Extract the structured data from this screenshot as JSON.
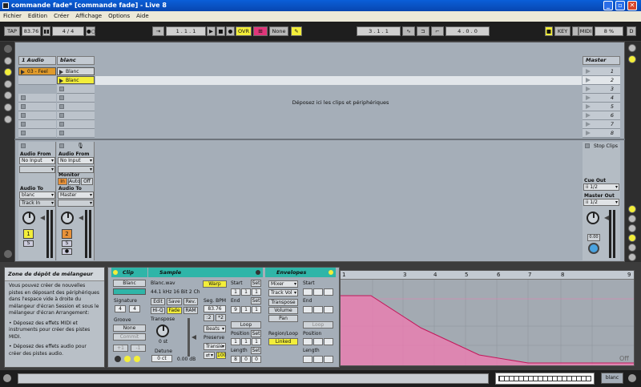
{
  "window": {
    "title": "commande fade*  [commande fade] - Live 8",
    "buttons": [
      "_",
      "▫",
      "✕"
    ]
  },
  "menu": [
    "Fichier",
    "Edition",
    "Créer",
    "Affichage",
    "Options",
    "Aide"
  ],
  "control": {
    "tap": "TAP",
    "tempo": "83.76",
    "sig": "4 / 4",
    "position": "1 . 1 . 1",
    "ovr": "OVR",
    "quant": "None",
    "loop_start": "3 . 1 . 1",
    "loop_len": "4 . 0 . 0",
    "key": "KEY",
    "midi": "MIDI",
    "cpu": "8 %",
    "d_label": "D"
  },
  "tracks": [
    {
      "name": "1 Audio",
      "clip": "03 - Feel Re",
      "audio_from_label": "Audio From",
      "audio_from": "No Input",
      "audio_to_label": "Audio To",
      "audio_to": "blanc",
      "route": "Track In",
      "number": "1",
      "solo": "S"
    },
    {
      "name": "blanc",
      "clip0": "Blanc",
      "clip1": "Blanc",
      "audio_from_label": "Audio From",
      "audio_from": "No Input",
      "monitor_label": "Monitor",
      "monitor": [
        "In",
        "Auto",
        "Off"
      ],
      "audio_to_label": "Audio To",
      "audio_to": "Master",
      "number": "2",
      "solo": "S"
    }
  ],
  "drop_text": "Déposez ici les clips et périphériques",
  "master": {
    "name": "Master",
    "scenes": [
      "1",
      "2",
      "3",
      "4",
      "5",
      "6",
      "7",
      "8"
    ],
    "stop": "Stop Clips",
    "cue_label": "Cue Out",
    "cue": "ii 1/2",
    "master_label": "Master Out",
    "master_out": "ii 1/2",
    "val": "0.00"
  },
  "info": {
    "title": "Zone de dépôt de mélangeur",
    "body": "Vous pouvez créer de nouvelles pistes en déposant des périphériques dans l'espace vide à droite du mélangeur d'écran Session et sous le mélangeur d'écran Arrangement:",
    "b1": "Déposez des effets MIDI et instruments pour créer des pistes MIDI.",
    "b2": "Déposez des effets audio pour créer des pistes audio."
  },
  "clip": {
    "title": "Clip",
    "name": "Blanc",
    "sig_label": "Signature",
    "sig_n": "4",
    "sig_d": "4",
    "groove_label": "Groove",
    "groove": "None",
    "commit": "Commit",
    "p": "+1",
    "m": "-1"
  },
  "sample": {
    "title": "Sample",
    "file": "Blanc.wav",
    "meta": "44.1 kHz 16 Bit 2 Ch",
    "edit": "Edit",
    "save": "Save",
    "rev": "Rev.",
    "hiq": "Hi-Q",
    "fade": "Fade",
    "ram": "RAM",
    "transpose_label": "Transpose",
    "transpose": "0 st",
    "detune_label": "Detune",
    "detune": "0 ct",
    "gain": "0.00 dB",
    "warp": "Warp",
    "segbpm_label": "Seg. BPM",
    "segbpm": "83.76",
    "half": ":2",
    "dbl": "*2",
    "mode": "Beats",
    "preserve_label": "Preserve",
    "transient": "Transie",
    "fo_val": "100",
    "start_label": "Start",
    "set": "Set",
    "end_label": "End",
    "loop": "Loop",
    "position_label": "Position",
    "length_label": "Length",
    "start": [
      "1",
      "1",
      "1"
    ],
    "end": [
      "9",
      "1",
      "1"
    ],
    "pos": [
      "1",
      "1",
      "1"
    ],
    "len": [
      "8",
      "0",
      "0"
    ]
  },
  "envelopes": {
    "title": "Envelopes",
    "device": "Mixer",
    "control": "Track Vol",
    "transpose": "Transpose",
    "volume": "Volume",
    "pan": "Pan",
    "region_label": "Region/Loop",
    "linked": "Linked",
    "start_label": "Start",
    "end_label": "End",
    "loop": "Loop",
    "position_label": "Position",
    "length_label": "Length"
  },
  "ruler": [
    "1",
    "3",
    "4",
    "5",
    "6",
    "7",
    "8",
    "9"
  ],
  "envelope_off": "Off",
  "statusbar": {
    "track": "blanc"
  },
  "colors": {
    "clip_orange": "#e09a2a",
    "clip_yellow": "#f3ee3a",
    "envelope": "#f07ab0",
    "teal": "#2fb5a8"
  }
}
